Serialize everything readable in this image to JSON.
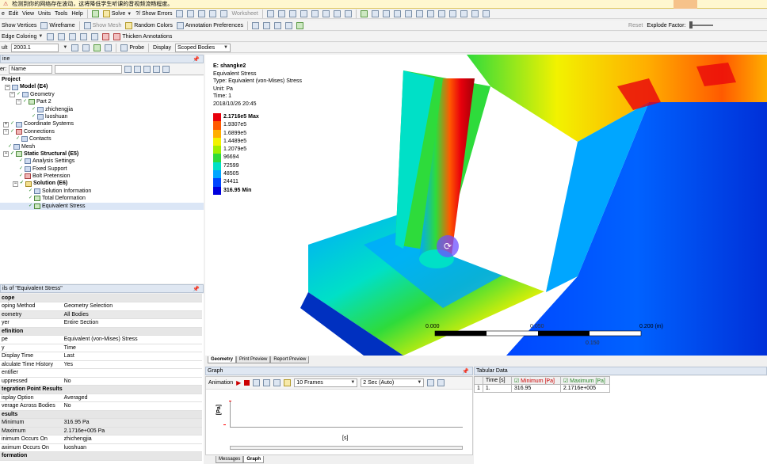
{
  "notice_bar": {
    "text": "检测到你的网络存在波动，这将降低学生听课的音视频流畅程度。"
  },
  "menu": {
    "items": [
      "e",
      "Edit",
      "View",
      "Units",
      "Tools",
      "Help"
    ],
    "solve": "Solve",
    "show_errors": "?/ Show Errors",
    "worksheet": "Worksheet"
  },
  "toolbar2": {
    "show_vertices": "Show Vertices",
    "wireframe": "Wireframe",
    "show_mesh": "Show Mesh",
    "random_colors": "Random Colors",
    "annotation_prefs": "Annotation Preferences",
    "reset": "Reset",
    "explode_factor": "Explode Factor:"
  },
  "toolbar3": {
    "edge_coloring": "Edge Coloring",
    "thicken_annotations": "Thicken Annotations"
  },
  "toolbar4": {
    "result_label": "ult",
    "result_value": "2003.1",
    "probe": "Probe",
    "display": "Display",
    "scoped_bodies": "Scoped Bodies"
  },
  "outline": {
    "title": "ine",
    "filter_label": "er:",
    "filter_value": "Name",
    "items": [
      "Project",
      "Model (E4)",
      "Geometry",
      "Part 2",
      "zhichengjia",
      "luoshuan",
      "Coordinate Systems",
      "Connections",
      "Contacts",
      "Mesh",
      "Static Structural (E5)",
      "Analysis Settings",
      "Fixed Support",
      "Bolt Pretension",
      "Solution (E6)",
      "Solution Information",
      "Total Deformation",
      "Equivalent Stress"
    ]
  },
  "details": {
    "title": "ils of \"Equivalent Stress\"",
    "rows": [
      {
        "k": "cope",
        "v": "",
        "sec": true
      },
      {
        "k": "oping Method",
        "v": "Geometry Selection"
      },
      {
        "k": "eometry",
        "v": "All Bodies",
        "hl": true
      },
      {
        "k": "yer",
        "v": "Entire Section"
      },
      {
        "k": "efinition",
        "v": "",
        "sec": true
      },
      {
        "k": "pe",
        "v": "Equivalent (von-Mises) Stress"
      },
      {
        "k": "y",
        "v": "Time"
      },
      {
        "k": "Display Time",
        "v": "Last"
      },
      {
        "k": "alculate Time History",
        "v": "Yes"
      },
      {
        "k": "entifier",
        "v": ""
      },
      {
        "k": "uppressed",
        "v": "No"
      },
      {
        "k": "tegration Point Results",
        "v": "",
        "sec": true
      },
      {
        "k": "isplay Option",
        "v": "Averaged"
      },
      {
        "k": "verage Across Bodies",
        "v": "No"
      },
      {
        "k": "esults",
        "v": "",
        "sec": true
      },
      {
        "k": "Minimum",
        "v": "316.95 Pa",
        "hl": true
      },
      {
        "k": "Maximum",
        "v": "2.1716e+005 Pa",
        "hl": true
      },
      {
        "k": "inimum Occurs On",
        "v": "zhichengjia"
      },
      {
        "k": "aximum Occurs On",
        "v": "luoshuan"
      },
      {
        "k": "formation",
        "v": "",
        "sec": true
      }
    ]
  },
  "viewport": {
    "title": "E: shangke2",
    "lines": [
      "Equivalent Stress",
      "Type: Equivalent (von-Mises) Stress",
      "Unit: Pa",
      "Time: 1",
      "2018/10/26 20:45"
    ],
    "legend": [
      {
        "label": "2.1716e5 Max",
        "color": "#e8000c",
        "bold": true
      },
      {
        "label": "1.9307e5",
        "color": "#ff5a00"
      },
      {
        "label": "1.6899e5",
        "color": "#ffae00"
      },
      {
        "label": "1.4489e5",
        "color": "#f2f200"
      },
      {
        "label": "1.2079e5",
        "color": "#a0ef00"
      },
      {
        "label": "96694",
        "color": "#2edb3b"
      },
      {
        "label": "72599",
        "color": "#00e0c7"
      },
      {
        "label": "48505",
        "color": "#00a6ff"
      },
      {
        "label": "24411",
        "color": "#0046ff"
      },
      {
        "label": "316.95 Min",
        "color": "#0000dd",
        "bold": true
      }
    ],
    "scale": {
      "left": "0.000",
      "right": "0.200 (m)",
      "mid1": "0.050",
      "mid2": "0.150"
    },
    "tabs": [
      "Geometry",
      "Print Preview",
      "Report Preview"
    ]
  },
  "graph": {
    "title": "Graph",
    "animation": "Animation",
    "frames": "10 Frames",
    "duration": "2 Sec (Auto)",
    "ylabel": "[Pa]",
    "xlabel": "[s]",
    "tick": "1."
  },
  "tabular": {
    "title": "Tabular Data",
    "headers": [
      "Time [s]",
      "Minimum [Pa]",
      "Maximum [Pa]"
    ],
    "rows": [
      [
        "1",
        "1.",
        "316.95",
        "2.1716e+005"
      ]
    ]
  },
  "bottom_tabs": [
    "Messages",
    "Graph"
  ]
}
